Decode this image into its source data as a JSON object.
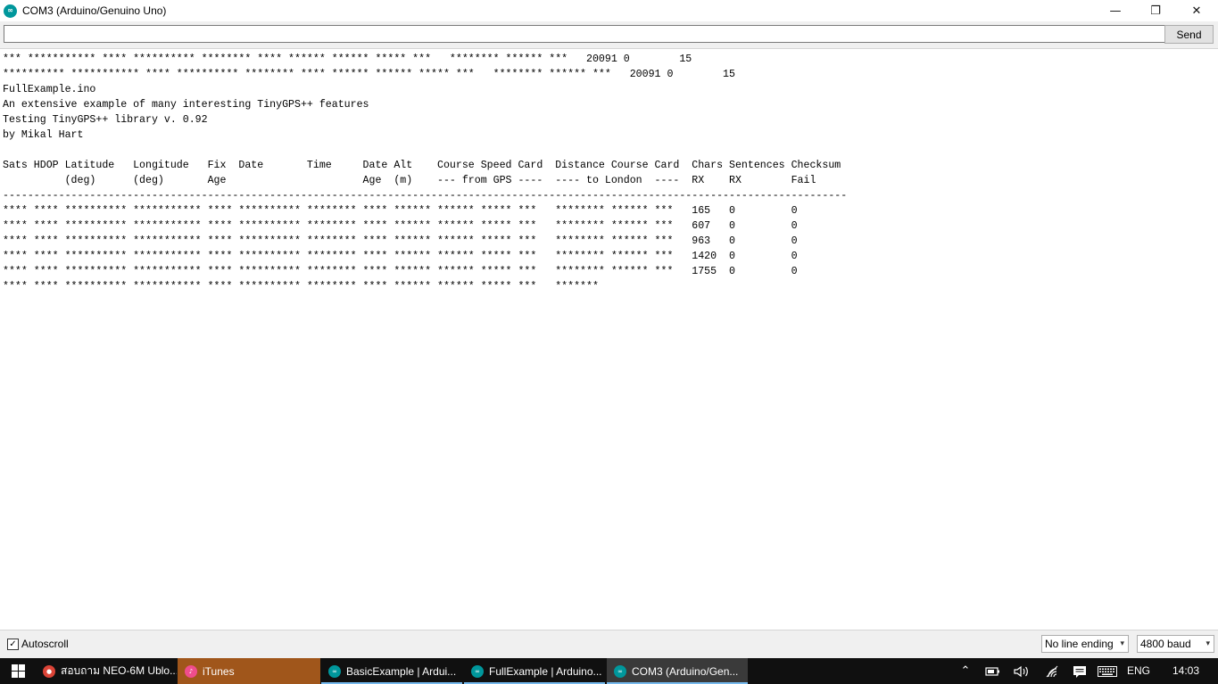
{
  "window": {
    "title": "COM3 (Arduino/Genuino Uno)",
    "logo_glyph": "∞",
    "minimize_glyph": "—",
    "restore_glyph": "❐",
    "close_glyph": "✕"
  },
  "input": {
    "value": "",
    "send_label": "Send"
  },
  "output": {
    "lines": [
      "*** *********** **** ********** ******** **** ****** ****** ***** ***   ******** ****** ***   20091 0        15",
      "********** *********** **** ********** ******** **** ****** ****** ***** ***   ******** ****** ***   20091 0        15",
      "FullExample.ino",
      "An extensive example of many interesting TinyGPS++ features",
      "Testing TinyGPS++ library v. 0.92",
      "by Mikal Hart",
      "",
      "Sats HDOP Latitude   Longitude   Fix  Date       Time     Date Alt    Course Speed Card  Distance Course Card  Chars Sentences Checksum",
      "          (deg)      (deg)       Age                      Age  (m)    --- from GPS ----  ---- to London  ----  RX    RX        Fail",
      "----------------------------------------------------------------------------------------------------------------------------------------",
      "**** **** ********** *********** **** ********** ******** **** ****** ****** ***** ***   ******** ****** ***   165   0         0",
      "**** **** ********** *********** **** ********** ******** **** ****** ****** ***** ***   ******** ****** ***   607   0         0",
      "**** **** ********** *********** **** ********** ******** **** ****** ****** ***** ***   ******** ****** ***   963   0         0",
      "**** **** ********** *********** **** ********** ******** **** ****** ****** ***** ***   ******** ****** ***   1420  0         0",
      "**** **** ********** *********** **** ********** ******** **** ****** ****** ***** ***   ******** ****** ***   1755  0         0",
      "**** **** ********** *********** **** ********** ******** **** ****** ****** ***** ***   *******"
    ]
  },
  "footer": {
    "autoscroll_label": "Autoscroll",
    "autoscroll_checked": true,
    "autoscroll_check_glyph": "✓",
    "line_ending_value": "No line ending",
    "baud_value": "4800 baud",
    "chevron_glyph": "▾"
  },
  "taskbar": {
    "items": [
      {
        "label": "สอบถาม NEO-6M Ublo...",
        "icon": "chrome-icon",
        "icon_color": "#db4437",
        "active": false
      },
      {
        "label": "iTunes",
        "icon": "itunes-icon",
        "icon_color": "#ef4d8c",
        "active": false,
        "highlight": true
      },
      {
        "label": "BasicExample | Ardui...",
        "icon": "arduino-icon",
        "icon_color": "#00979c",
        "active": false
      },
      {
        "label": "FullExample | Arduino...",
        "icon": "arduino-icon",
        "icon_color": "#00979c",
        "active": false
      },
      {
        "label": "COM3 (Arduino/Gen...",
        "icon": "arduino-icon",
        "icon_color": "#00979c",
        "active": true
      }
    ],
    "tray": {
      "chevron_glyph": "⌃",
      "language": "ENG",
      "time": "14:03"
    }
  },
  "colors": {
    "arduino_teal": "#00979c",
    "itunes_task_bg": "#a0561b",
    "active_task_bg": "#3a3a3a",
    "taskbar_bg": "#101010"
  }
}
